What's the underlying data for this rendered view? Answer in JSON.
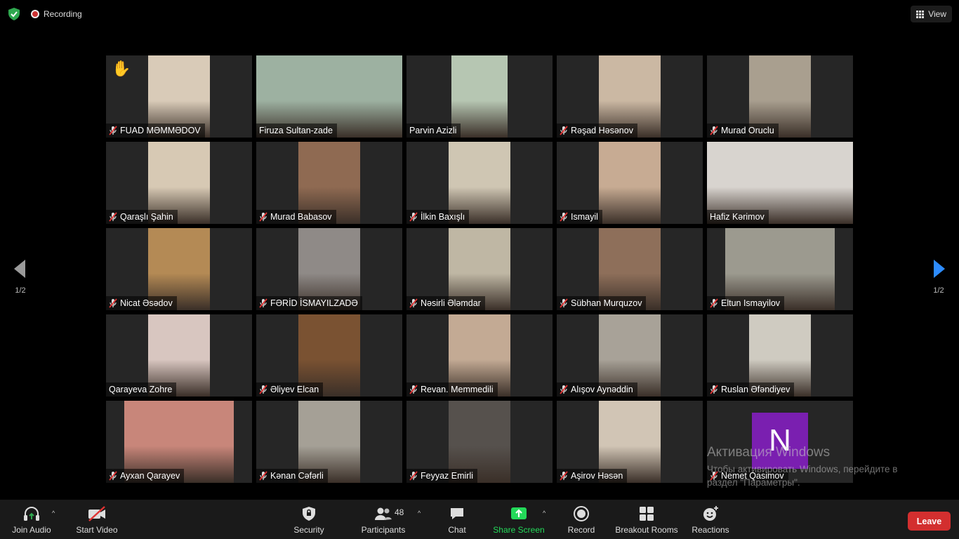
{
  "topbar": {
    "recording_label": "Recording",
    "view_label": "View"
  },
  "pagination": {
    "left_label": "1/2",
    "right_label": "1/2"
  },
  "tiles": [
    {
      "name": "FUAD MƏMMƏDOV",
      "muted": true,
      "hand": true,
      "video": "#d9cbb8",
      "vw": 88
    },
    {
      "name": "Firuza Sultan-zade",
      "muted": false,
      "active": true,
      "video": "#9db1a1",
      "vw": 208
    },
    {
      "name": "Parvin Azizli",
      "muted": false,
      "video": "#b6c6b2",
      "vw": 80
    },
    {
      "name": "Rəşad Həsənov",
      "muted": true,
      "video": "#cbb8a3",
      "vw": 88
    },
    {
      "name": "Murad Oruclu",
      "muted": true,
      "video": "#a99f8f",
      "vw": 88
    },
    {
      "name": "Qaraşlı Şahin",
      "muted": true,
      "video": "#d7c9b4",
      "vw": 88
    },
    {
      "name": "Murad Babasov",
      "muted": true,
      "video": "#8f6a52",
      "vw": 88
    },
    {
      "name": "İlkin Baxışlı",
      "muted": true,
      "video": "#cfc6b3",
      "vw": 88
    },
    {
      "name": "Ismayil",
      "muted": true,
      "video": "#c7ab93",
      "vw": 88
    },
    {
      "name": "Hafiz Kərimov",
      "muted": false,
      "video": "#d8d4cf",
      "vw": 208
    },
    {
      "name": "Nicat Əsədov",
      "muted": true,
      "video": "#b48a55",
      "vw": 88
    },
    {
      "name": "FƏRİD İSMAYILZADƏ",
      "muted": true,
      "video": "#8f8a87",
      "vw": 88
    },
    {
      "name": "Nəsirli Ələmdar",
      "muted": true,
      "video": "#bfb7a4",
      "vw": 88
    },
    {
      "name": "Sübhan Murquzov",
      "muted": true,
      "video": "#8e6f5a",
      "vw": 88
    },
    {
      "name": "Eltun Ismayilov",
      "muted": true,
      "video": "#9c9a8f",
      "vw": 156
    },
    {
      "name": "Qarayeva Zohre",
      "muted": false,
      "video": "#d8c6c0",
      "vw": 88
    },
    {
      "name": "Əliyev Elcan",
      "muted": true,
      "video": "#7a5232",
      "vw": 88
    },
    {
      "name": "Revan. Memmedili",
      "muted": true,
      "video": "#c3aa94",
      "vw": 88
    },
    {
      "name": "Alışov Aynəddin",
      "muted": true,
      "video": "#a8a298",
      "vw": 88
    },
    {
      "name": "Ruslan Əfəndiyev",
      "muted": true,
      "video": "#cfcbc1",
      "vw": 88
    },
    {
      "name": "Ayxan Qarayev",
      "muted": true,
      "video": "#c8867a",
      "vw": 156
    },
    {
      "name": "Kənan Cəfərli",
      "muted": true,
      "video": "#a5a096",
      "vw": 88
    },
    {
      "name": "Feyyaz Emirli",
      "muted": true,
      "video": "#56514d",
      "vw": 88
    },
    {
      "name": "Aşirov Həsən",
      "muted": true,
      "video": "#d1c5b5",
      "vw": 88
    },
    {
      "name": "Nemet Qasimov",
      "muted": true,
      "avatar": "N",
      "video": "",
      "vw": 0
    }
  ],
  "watermark": {
    "title": "Активация Windows",
    "line1": "Чтобы активировать Windows, перейдите в",
    "line2": "раздел \"Параметры\"."
  },
  "toolbar": {
    "join_audio": "Join Audio",
    "start_video": "Start Video",
    "security": "Security",
    "participants": "Participants",
    "participants_count": "48",
    "chat": "Chat",
    "share_screen": "Share Screen",
    "record": "Record",
    "breakout_rooms": "Breakout Rooms",
    "reactions": "Reactions",
    "leave": "Leave"
  },
  "colors": {
    "share_green": "#23d959",
    "leave_red": "#d32f2f",
    "active_speaker": "#e6e24a",
    "avatar_purple": "#7a1fb0"
  }
}
